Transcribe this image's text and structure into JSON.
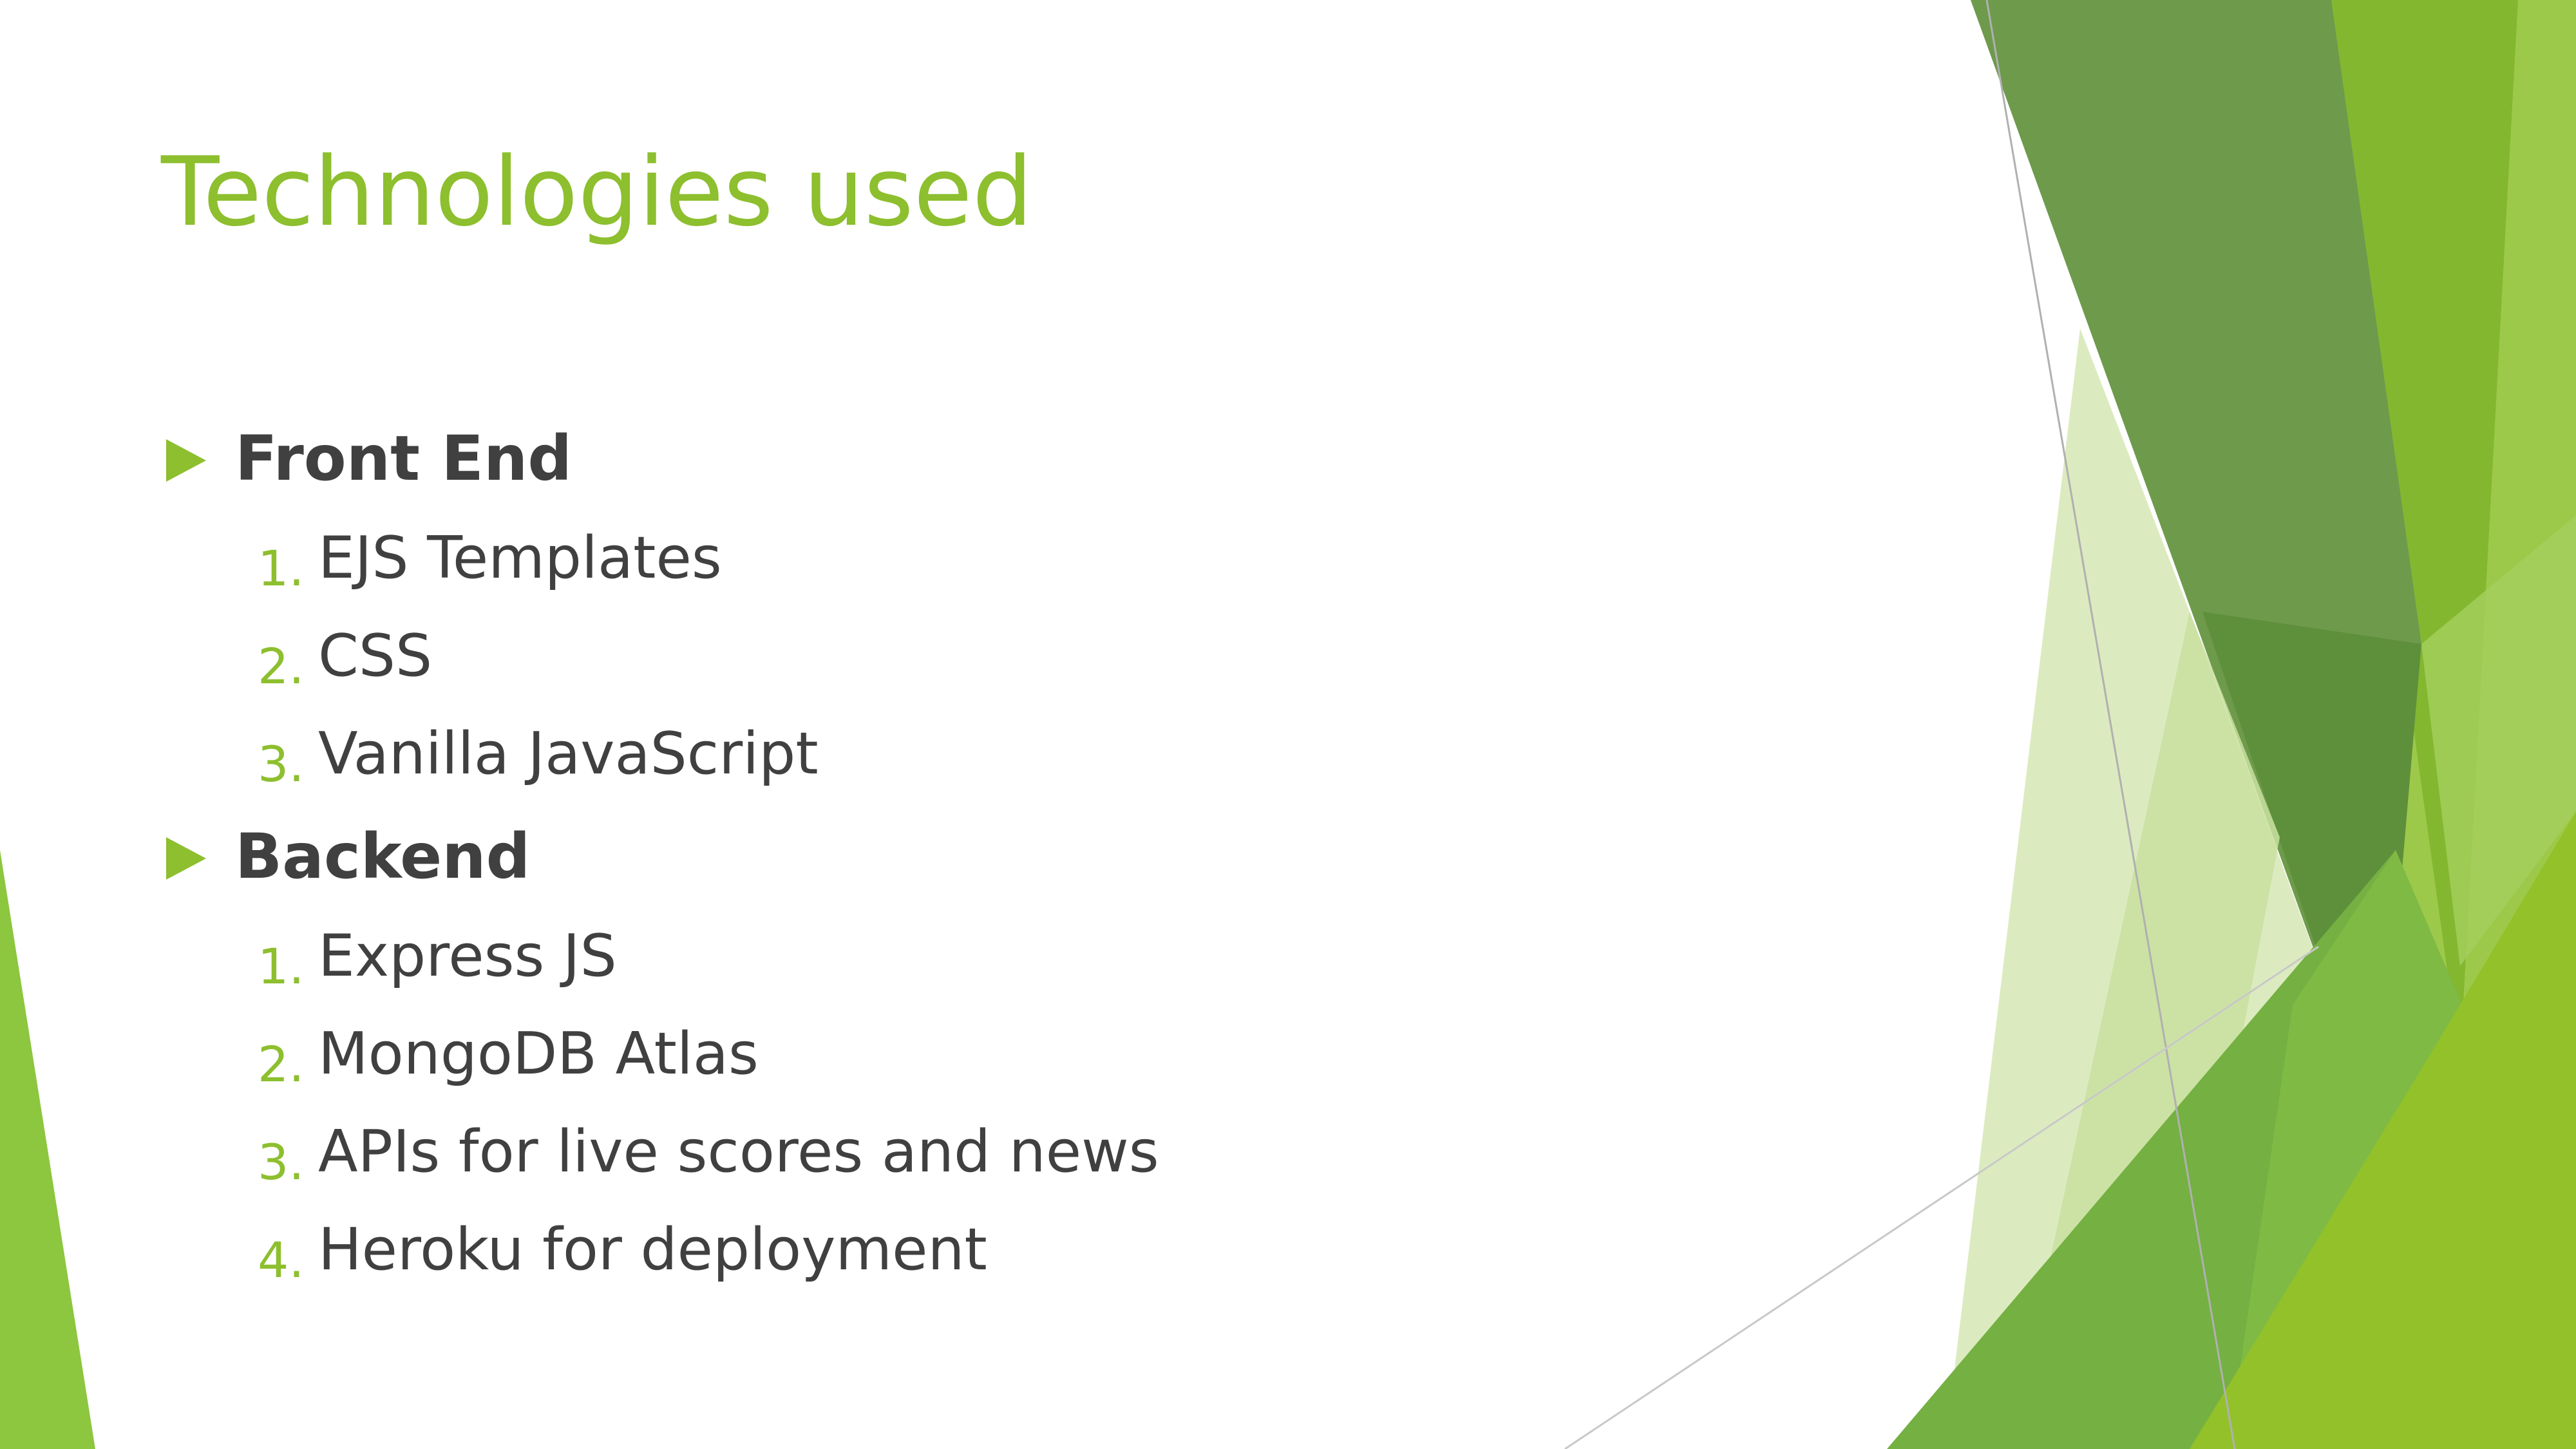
{
  "slide": {
    "title": "Technologies used",
    "sections": [
      {
        "heading": "Front End",
        "items": [
          {
            "num": "1.",
            "text": "EJS Templates"
          },
          {
            "num": "2.",
            "text": "CSS"
          },
          {
            "num": "3.",
            "text": "Vanilla JavaScript"
          }
        ]
      },
      {
        "heading": "Backend",
        "items": [
          {
            "num": "1.",
            "text": "Express JS"
          },
          {
            "num": "2.",
            "text": "MongoDB Atlas"
          },
          {
            "num": "3.",
            "text": "APIs for live scores and news"
          },
          {
            "num": "4.",
            "text": "Heroku for deployment"
          }
        ]
      }
    ]
  },
  "theme": {
    "accent": "#8dbf2e",
    "text": "#404040",
    "dark_green": "#6a9a3f",
    "mid_green": "#7cb342",
    "light_green": "#d9e8bd"
  },
  "icons": {
    "bullet": "triangle-right-icon"
  }
}
